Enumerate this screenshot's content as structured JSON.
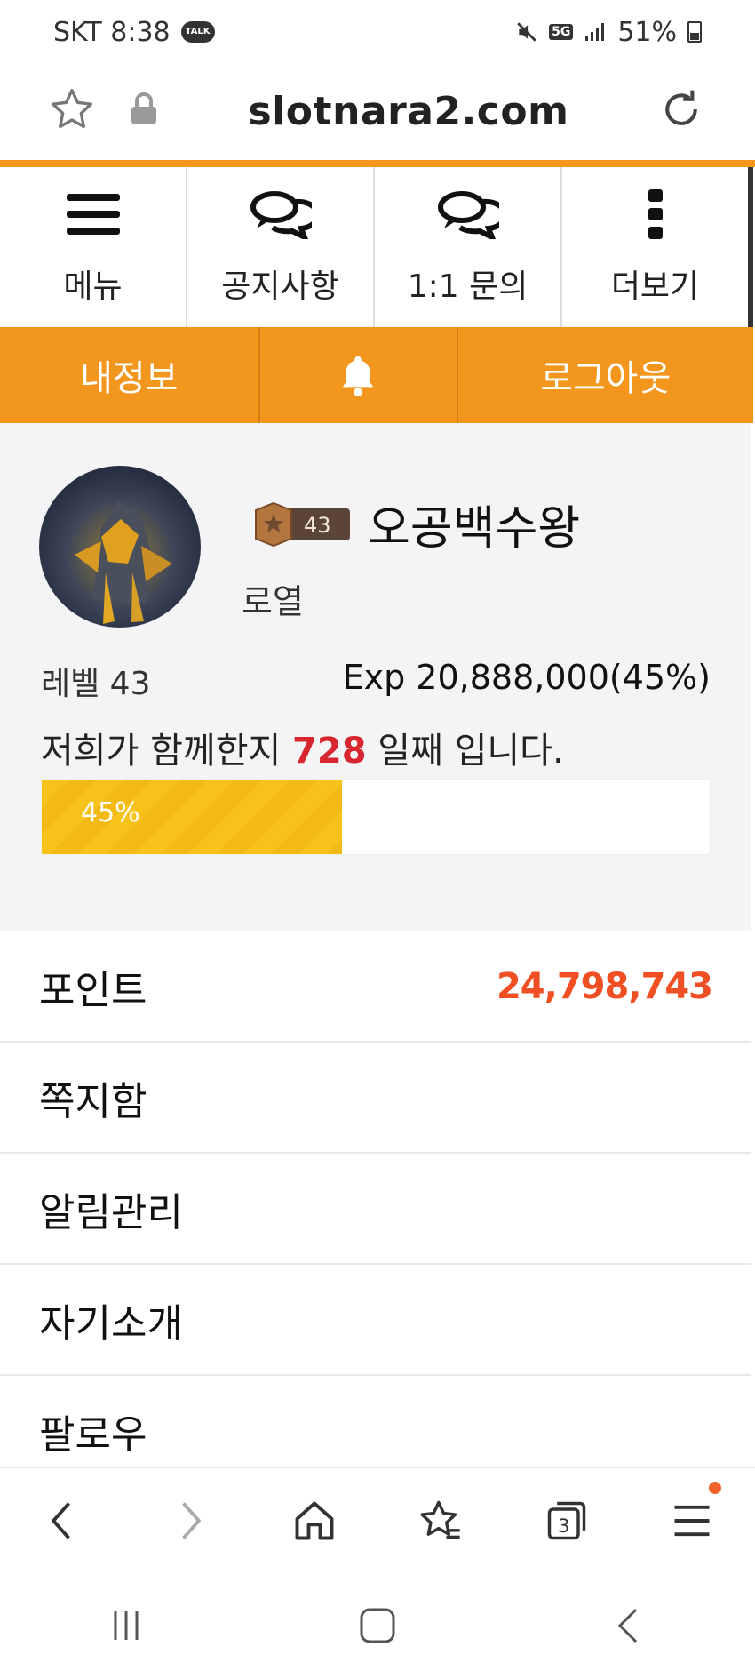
{
  "status_bar": {
    "carrier_time": "SKT 8:38",
    "talk_badge": "TALK",
    "network": "5G",
    "battery": "51%"
  },
  "url_bar": {
    "url": "slotnara2.com"
  },
  "top_nav": {
    "items": [
      {
        "label": "메뉴",
        "icon": "hamburger-menu-icon"
      },
      {
        "label": "공지사항",
        "icon": "chat-bubbles-icon"
      },
      {
        "label": "1:1 문의",
        "icon": "chat-bubbles-icon"
      },
      {
        "label": "더보기",
        "icon": "more-vertical-icon"
      }
    ]
  },
  "orange_bar": {
    "my_info": "내정보",
    "bell_icon": "bell-icon",
    "logout": "로그아웃"
  },
  "profile": {
    "level_badge": "43",
    "username": "오공백수왕",
    "grade": "로열",
    "level": "레벨 43",
    "exp": "Exp 20,888,000(45%)",
    "days_prefix": "저희가 함께한지",
    "days_count": "728",
    "days_suffix": "일째 입니다.",
    "progress_label": "45%",
    "progress_fraction": 0.45
  },
  "menu": {
    "items": [
      {
        "label": "포인트",
        "value": "24,798,743"
      },
      {
        "label": "쪽지함",
        "value": ""
      },
      {
        "label": "알림관리",
        "value": ""
      },
      {
        "label": "자기소개",
        "value": ""
      },
      {
        "label": "팔로우",
        "value": ""
      }
    ]
  },
  "toolbar": {
    "icons": [
      "back-icon",
      "forward-icon",
      "home-icon",
      "bookmarks-icon",
      "tabs-icon",
      "browser-menu-icon"
    ],
    "tabs_count": "3"
  },
  "colors": {
    "accent": "#f2961e",
    "points": "#f04e23",
    "days": "#d8262e",
    "progress": "#f7c31b"
  }
}
